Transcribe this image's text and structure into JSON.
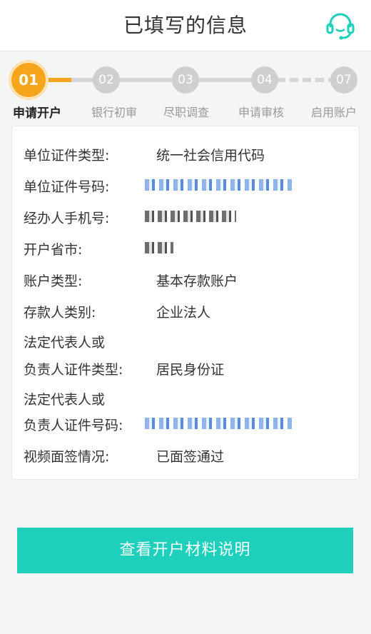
{
  "header": {
    "title": "已填写的信息",
    "service_icon": "customer-service-headset-icon",
    "accent_color": "#1ecfbc"
  },
  "steps": [
    {
      "num": "01",
      "label": "申请开户",
      "active": true
    },
    {
      "num": "02",
      "label": "银行初审",
      "active": false
    },
    {
      "num": "03",
      "label": "尽职调查",
      "active": false
    },
    {
      "num": "04",
      "label": "申请审核",
      "active": false
    },
    {
      "num": "07",
      "label": "启用账户",
      "active": false
    }
  ],
  "step_active_color": "#f7a51c",
  "info": {
    "unit_cert_type_label": "单位证件类型:",
    "unit_cert_type_value": "统一社会信用代码",
    "unit_cert_no_label": "单位证件号码:",
    "operator_phone_label": "经办人手机号:",
    "province_city_label": "开户省市:",
    "account_type_label": "账户类型:",
    "account_type_value": "基本存款账户",
    "depositor_type_label": "存款人类别:",
    "depositor_type_value": "企业法人",
    "legal_rep_cert_type_label_1": "法定代表人或",
    "legal_rep_cert_type_label_2": "负责人证件类型:",
    "legal_rep_cert_type_value": "居民身份证",
    "legal_rep_cert_no_label_1": "法定代表人或",
    "legal_rep_cert_no_label_2": "负责人证件号码:",
    "video_sign_label": "视频面签情况:",
    "video_sign_value": "已面签通过"
  },
  "button": {
    "label": "查看开户材料说明"
  }
}
